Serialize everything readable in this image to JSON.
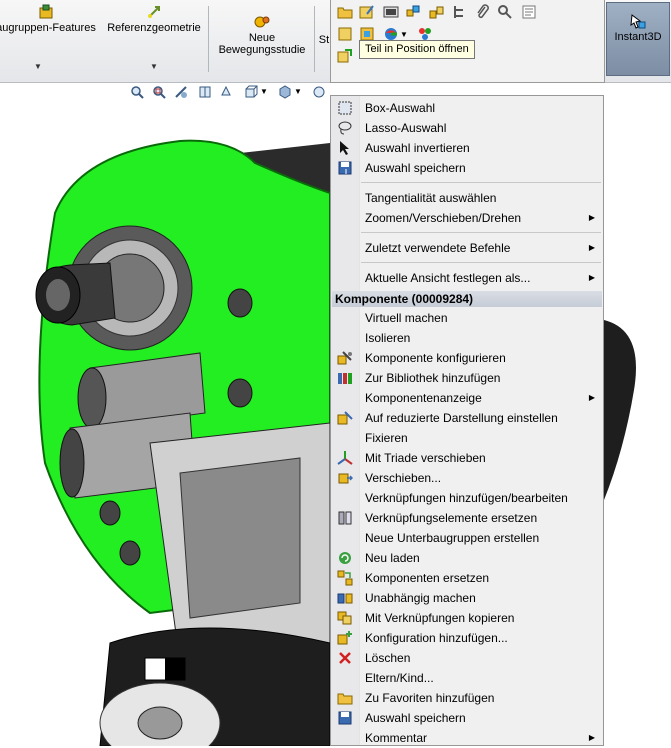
{
  "ribbon": {
    "items": [
      {
        "label": "augruppen-Features"
      },
      {
        "label": "Referenzgeometrie"
      },
      {
        "label_line1": "Neue",
        "label_line2": "Bewegungsstudie"
      },
      {
        "label": "St"
      }
    ],
    "instant3d": "Instant3D"
  },
  "tooltip": "Teil in Position öffnen",
  "context_menu": {
    "section1": [
      "Box-Auswahl",
      "Lasso-Auswahl",
      "Auswahl invertieren",
      "Auswahl speichern"
    ],
    "section2": [
      "Tangentialität auswählen",
      "Zoomen/Verschieben/Drehen"
    ],
    "section3": [
      "Zuletzt verwendete Befehle"
    ],
    "section4": [
      "Aktuelle Ansicht festlegen als..."
    ],
    "header": "Komponente (00009284)",
    "section5": [
      "Virtuell machen",
      "Isolieren",
      "Komponente konfigurieren",
      "Zur Bibliothek hinzufügen",
      "Komponentenanzeige",
      "Auf reduzierte Darstellung einstellen",
      "Fixieren",
      "Mit Triade verschieben",
      "Verschieben...",
      "Verknüpfungen hinzufügen/bearbeiten",
      "Verknüpfungselemente ersetzen",
      "Neue Unterbaugruppen erstellen",
      "Neu laden",
      "Komponenten ersetzen",
      "Unabhängig machen",
      "Mit Verknüpfungen kopieren",
      "Konfiguration hinzufügen...",
      "Löschen",
      "Eltern/Kind...",
      "Zu Favoriten hinzufügen",
      "Auswahl speichern",
      "Kommentar"
    ]
  },
  "colors": {
    "selection_green": "#22ee22",
    "accent": "#7d8ea4"
  }
}
